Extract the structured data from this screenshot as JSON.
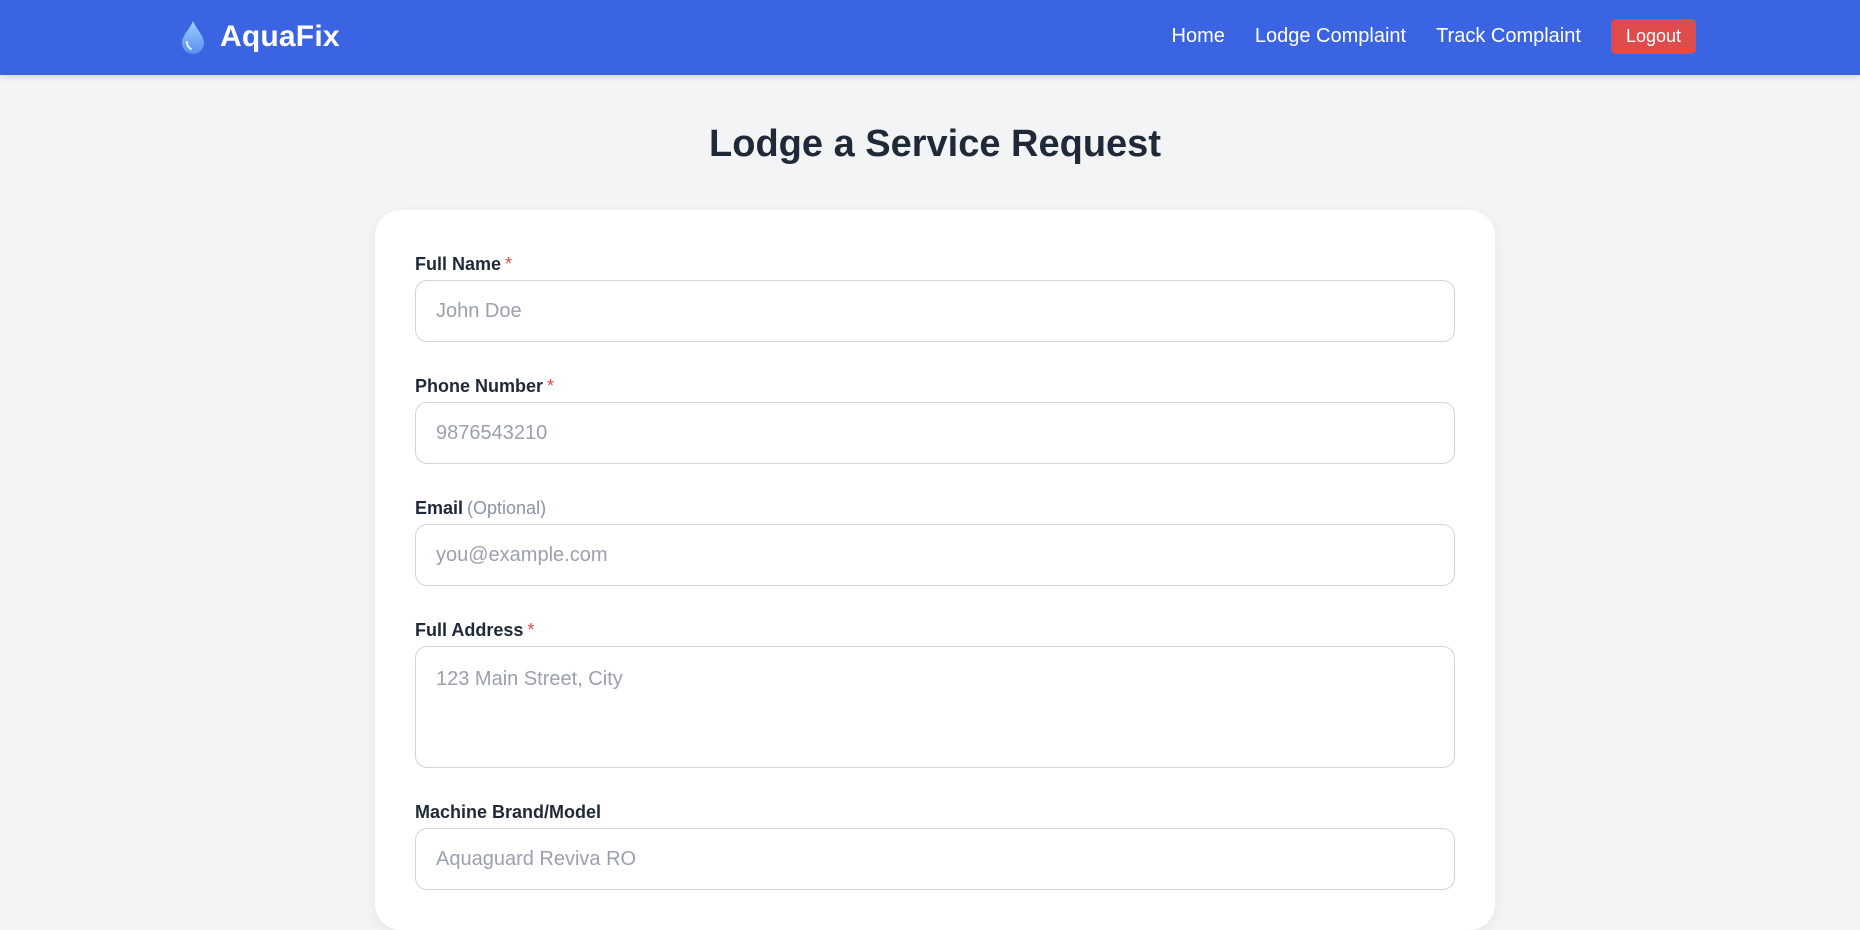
{
  "nav": {
    "brand": "AquaFix",
    "links": [
      "Home",
      "Lodge Complaint",
      "Track Complaint"
    ],
    "logout_label": "Logout",
    "brand_icon": "water-drop-icon"
  },
  "page": {
    "title": "Lodge a Service Request"
  },
  "form": {
    "full_name": {
      "label": "Full Name",
      "required_mark": "*",
      "placeholder": "John Doe",
      "value": ""
    },
    "phone": {
      "label": "Phone Number",
      "required_mark": "*",
      "placeholder": "9876543210",
      "value": ""
    },
    "email": {
      "label": "Email",
      "optional_note": "(Optional)",
      "placeholder": "you@example.com",
      "value": ""
    },
    "address": {
      "label": "Full Address",
      "required_mark": "*",
      "placeholder": "123 Main Street, City",
      "value": ""
    },
    "machine": {
      "label": "Machine Brand/Model",
      "placeholder": "Aquaguard Reviva RO",
      "value": ""
    }
  },
  "colors": {
    "navbar": "#3b64e3",
    "logout": "#e04b4b",
    "page_bg": "#f3f4f6",
    "required": "#e04b4b"
  }
}
